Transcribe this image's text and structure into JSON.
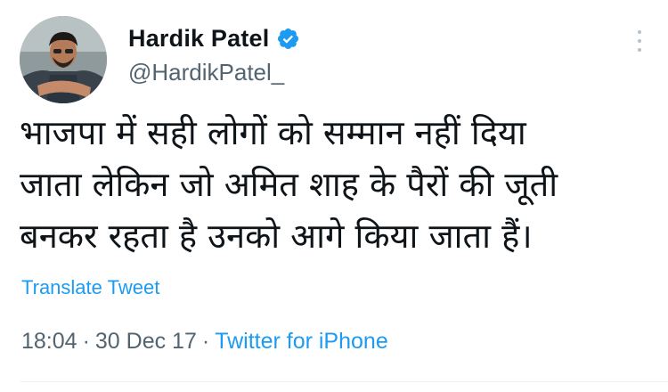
{
  "author": {
    "display_name": "Hardik Patel",
    "handle": "@HardikPatel_",
    "verified": true,
    "verified_color": "#1d9bf0"
  },
  "tweet": {
    "text": "भाजपा में सही लोगों को सम्मान नहीं दिया\nजाता लेकिन जो अमित शाह के पैरों की जूती\nबनकर रहता है उनको आगे किया जाता हैं।",
    "translate_label": "Translate Tweet",
    "time": "18:04",
    "date": "30 Dec 17",
    "separator": "·",
    "source": "Twitter for iPhone"
  },
  "icons": {
    "verified": "verified-badge-icon",
    "more": "more-options-icon"
  },
  "colors": {
    "link": "#1d9bf0",
    "secondary_text": "#536471",
    "primary_text": "#0f1419"
  }
}
